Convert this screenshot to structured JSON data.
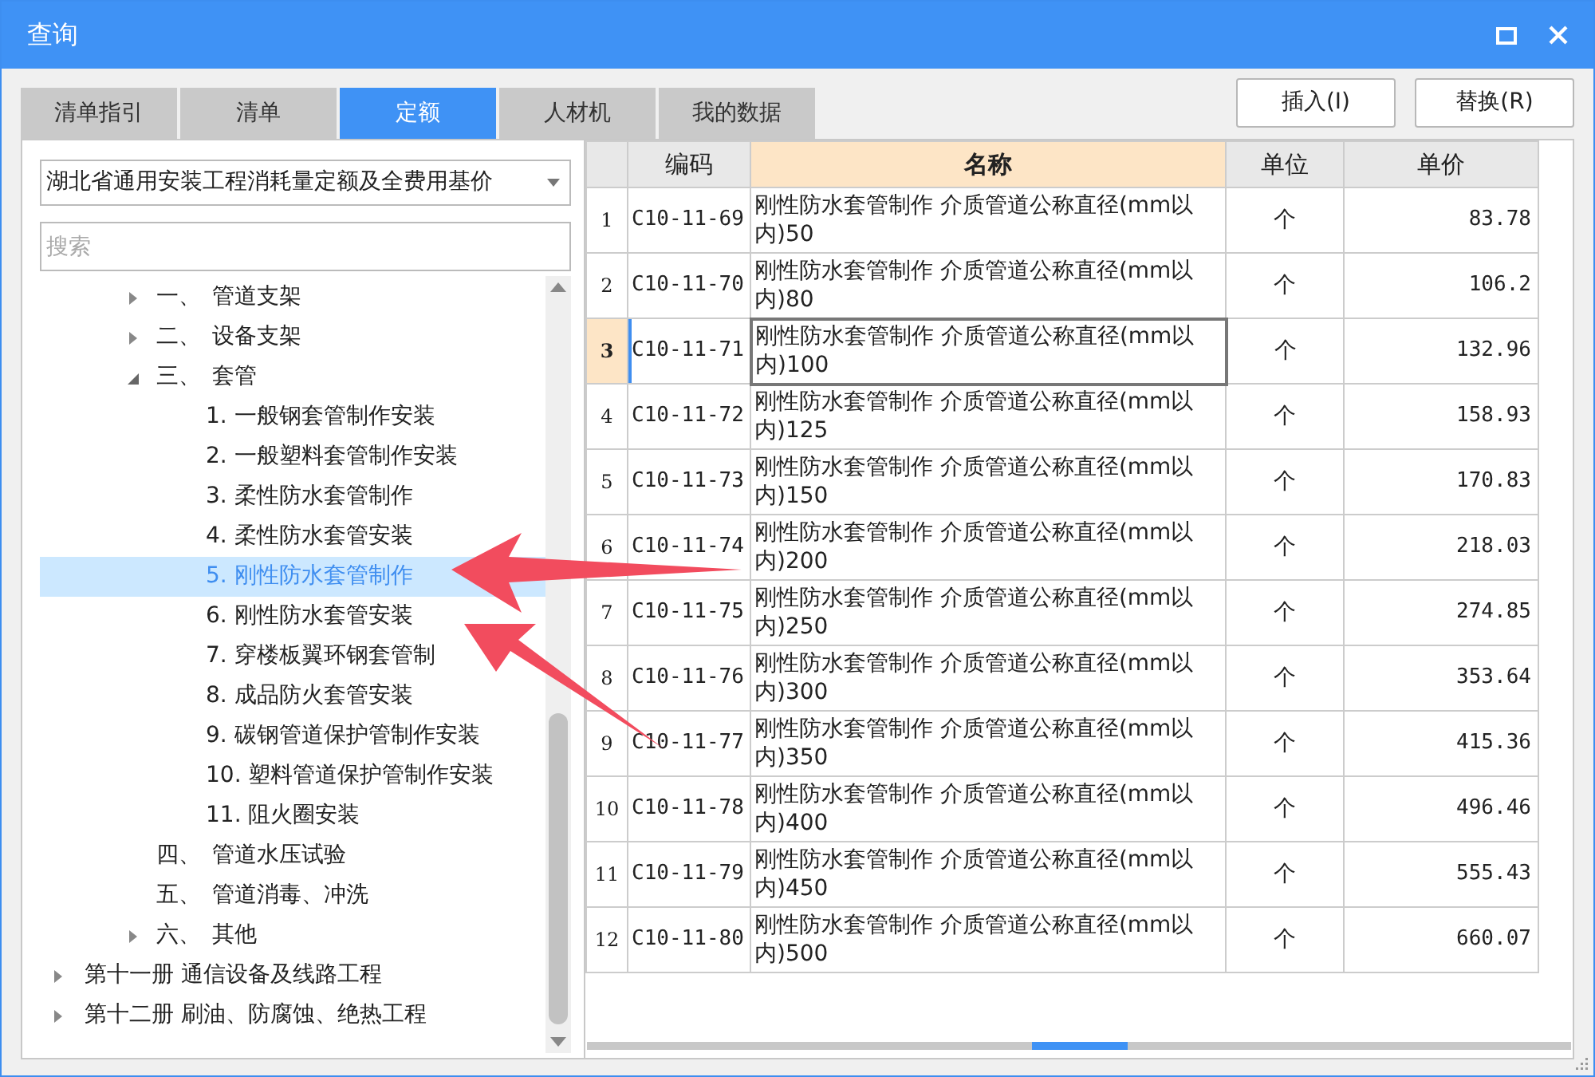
{
  "window": {
    "title": "查询"
  },
  "tabs": [
    {
      "label": "清单指引",
      "selected": false
    },
    {
      "label": "清单",
      "selected": false
    },
    {
      "label": "定额",
      "selected": true
    },
    {
      "label": "人材机",
      "selected": false
    },
    {
      "label": "我的数据",
      "selected": false
    }
  ],
  "buttons": [
    "插入(I)",
    "替换(R)"
  ],
  "library_select": {
    "value": "湖北省通用安装工程消耗量定额及全费用基价"
  },
  "search": {
    "placeholder": "搜索"
  },
  "tree": {
    "continued": [
      {
        "num": "一、",
        "label": "管道支架",
        "expanded": false,
        "selected": false
      },
      {
        "num": "二、",
        "label": "设备支架",
        "expanded": false,
        "selected": false
      },
      {
        "num": "三、",
        "label": "套管",
        "expanded": true,
        "selected": false,
        "children": [
          {
            "label": "1. 一般钢套管制作安装",
            "selected": false
          },
          {
            "label": "2. 一般塑料套管制作安装",
            "selected": false
          },
          {
            "label": "3. 柔性防水套管制作",
            "selected": false
          },
          {
            "label": "4. 柔性防水套管安装",
            "selected": false
          },
          {
            "label": "5. 刚性防水套管制作",
            "selected": true
          },
          {
            "label": "6. 刚性防水套管安装",
            "selected": false
          },
          {
            "label": "7. 穿楼板翼环钢套管制",
            "selected": false
          },
          {
            "label": "8. 成品防火套管安装",
            "selected": false
          },
          {
            "label": "9. 碳钢管道保护管制作安装",
            "selected": false
          },
          {
            "label": "10. 塑料管道保护管制作安装",
            "selected": false
          },
          {
            "label": "11. 阻火圈安装",
            "selected": false
          }
        ]
      },
      {
        "num": "四、",
        "label": "管道水压试验",
        "selected": false
      },
      {
        "num": "五、",
        "label": "管道消毒、冲洗",
        "selected": false
      },
      {
        "num": "六、",
        "label": "其他",
        "expanded": false,
        "selected": false
      }
    ],
    "items": [
      {
        "label": "第十一册 通信设备及线路工程",
        "expanded": false,
        "selected": false
      },
      {
        "label": "第十二册 刷油、防腐蚀、绝热工程",
        "expanded": false,
        "selected": false
      }
    ]
  },
  "table": {
    "columns": [
      {
        "label": "编码",
        "highlighted": false
      },
      {
        "label": "名称",
        "highlighted": true
      },
      {
        "label": "单位",
        "highlighted": false
      },
      {
        "label": "单价",
        "highlighted": false
      }
    ],
    "rows": [
      {
        "index": "1",
        "code": "C10-11-69",
        "name": "刚性防水套管制作 介质管道公称直径(mm以内)50",
        "unit": "个",
        "price": "83.78",
        "selected": false
      },
      {
        "index": "2",
        "code": "C10-11-70",
        "name": "刚性防水套管制作 介质管道公称直径(mm以内)80",
        "unit": "个",
        "price": "106.2",
        "selected": false
      },
      {
        "index": "3",
        "code": "C10-11-71",
        "name": "刚性防水套管制作 介质管道公称直径(mm以内)100",
        "unit": "个",
        "price": "132.96",
        "selected": true
      },
      {
        "index": "4",
        "code": "C10-11-72",
        "name": "刚性防水套管制作 介质管道公称直径(mm以内)125",
        "unit": "个",
        "price": "158.93",
        "selected": false
      },
      {
        "index": "5",
        "code": "C10-11-73",
        "name": "刚性防水套管制作 介质管道公称直径(mm以内)150",
        "unit": "个",
        "price": "170.83",
        "selected": false
      },
      {
        "index": "6",
        "code": "C10-11-74",
        "name": "刚性防水套管制作 介质管道公称直径(mm以内)200",
        "unit": "个",
        "price": "218.03",
        "selected": false
      },
      {
        "index": "7",
        "code": "C10-11-75",
        "name": "刚性防水套管制作 介质管道公称直径(mm以内)250",
        "unit": "个",
        "price": "274.85",
        "selected": false
      },
      {
        "index": "8",
        "code": "C10-11-76",
        "name": "刚性防水套管制作 介质管道公称直径(mm以内)300",
        "unit": "个",
        "price": "353.64",
        "selected": false
      },
      {
        "index": "9",
        "code": "C10-11-77",
        "name": "刚性防水套管制作 介质管道公称直径(mm以内)350",
        "unit": "个",
        "price": "415.36",
        "selected": false
      },
      {
        "index": "10",
        "code": "C10-11-78",
        "name": "刚性防水套管制作 介质管道公称直径(mm以内)400",
        "unit": "个",
        "price": "496.46",
        "selected": false
      },
      {
        "index": "11",
        "code": "C10-11-79",
        "name": "刚性防水套管制作 介质管道公称直径(mm以内)450",
        "unit": "个",
        "price": "555.43",
        "selected": false
      },
      {
        "index": "12",
        "code": "C10-11-80",
        "name": "刚性防水套管制作 介质管道公称直径(mm以内)500",
        "unit": "个",
        "price": "660.07",
        "selected": false
      }
    ]
  }
}
